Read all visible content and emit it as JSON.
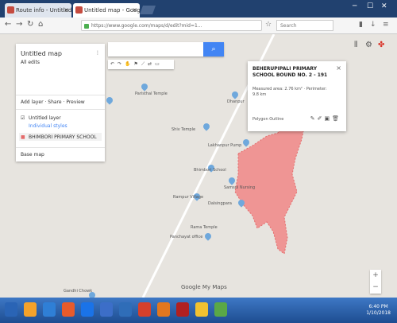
{
  "tabs": [
    {
      "label": "Route info - Untitled map",
      "color": "#c54b3f"
    },
    {
      "label": "Untitled map - Google My Ma",
      "color": "#c54b3f"
    }
  ],
  "address": "https://www.google.com/maps/d/edit?mid=1...",
  "search_placeholder": "Search",
  "map_search": {
    "button_icon": "search-icon"
  },
  "panel": {
    "title": "Untitled map",
    "subtitle": "All edits",
    "views": "Add layer · Share · Preview",
    "layer_title": "Untitled layer",
    "layer_style": "Individual styles",
    "polygon_item": "BHIMBORI PRIMARY SCHOOL",
    "base_map": "Base map"
  },
  "info": {
    "title": "BEHERUPIPALI PRIMARY SCHOOL BOUND NO. 2 - 191",
    "desc": "Measured area: 2.76 km² · Perimeter: 9.8 km",
    "foot": "Polygon Outline"
  },
  "labels": [
    "Paristhal Temple",
    "Dhanpur",
    "Shiv Temple",
    "Lakhanpur Pump",
    "Bhimbori School",
    "Samsul Nursing",
    "Rampur Village",
    "Dalsingpara",
    "Panchayat office",
    "Rama Temple",
    "Gandhi Chowk"
  ],
  "logo": "Google My Maps",
  "clock": {
    "time": "6:40 PM",
    "date": "1/10/2018"
  }
}
